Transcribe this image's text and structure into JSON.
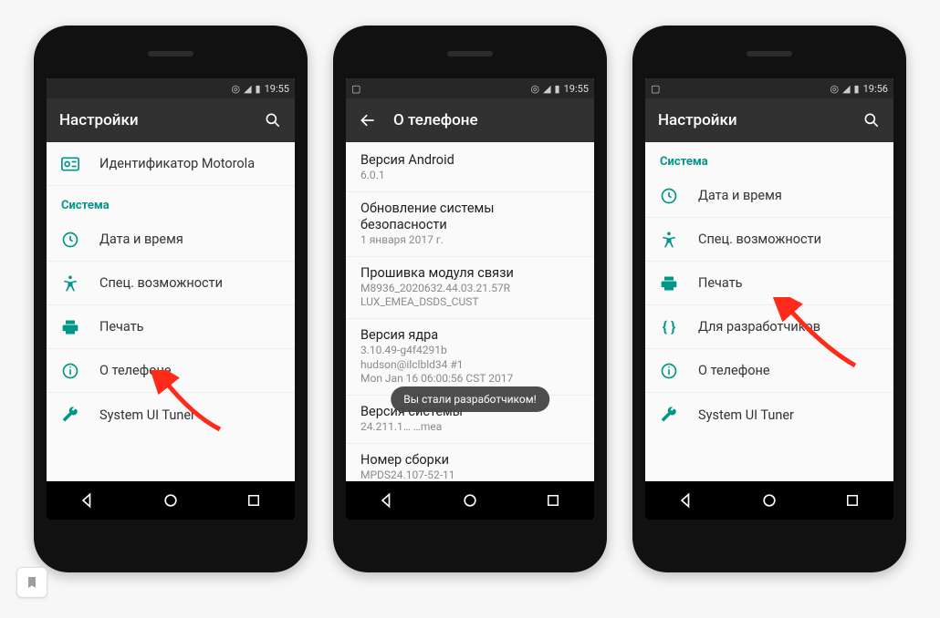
{
  "phones": [
    {
      "status": {
        "time": "19:55",
        "left_icons": [],
        "right_icons": [
          "©",
          "▲",
          "▮"
        ]
      },
      "appbar": {
        "back": false,
        "title": "Настройки",
        "search": true
      },
      "top_row": {
        "icon": "id-icon",
        "label": "Идентификатор Motorola"
      },
      "section_header": "Система",
      "items": [
        {
          "icon": "clock-icon",
          "label": "Дата и время"
        },
        {
          "icon": "access-icon",
          "label": "Спец. возможности"
        },
        {
          "icon": "print-icon",
          "label": "Печать"
        },
        {
          "icon": "info-icon",
          "label": "О телефоне"
        },
        {
          "icon": "wrench-icon",
          "label": "System UI Tuner"
        }
      ],
      "arrow_target": 3
    },
    {
      "status": {
        "time": "19:55",
        "left_icons": [
          "▢"
        ],
        "right_icons": [
          "©",
          "▲",
          "▮"
        ]
      },
      "appbar": {
        "back": true,
        "title": "О телефоне",
        "search": false
      },
      "info_blocks": [
        {
          "title": "Версия Android",
          "sub": "6.0.1"
        },
        {
          "title": "Обновление системы безопасности",
          "sub": "1 января 2017 г."
        },
        {
          "title": "Прошивка модуля связи",
          "sub": "M8936_2020632.44.03.21.57R\nLUX_EMEA_DSDS_CUST"
        },
        {
          "title": "Версия ядра",
          "sub": "3.10.49-g4f4291b\nhudson@ilclbld34 #1\nMon Jan 16 06:00:56 CST 2017"
        },
        {
          "title": "Версия системы",
          "sub": "24.211.1…                                                  …mea"
        },
        {
          "title": "Номер сборки",
          "sub": "MPDS24.107-52-11"
        }
      ],
      "toast": "Вы стали разработчиком!"
    },
    {
      "status": {
        "time": "19:56",
        "left_icons": [
          "▢"
        ],
        "right_icons": [
          "©",
          "▲",
          "▮"
        ]
      },
      "appbar": {
        "back": false,
        "title": "Настройки",
        "search": true
      },
      "section_header": "Система",
      "items": [
        {
          "icon": "clock-icon",
          "label": "Дата и время"
        },
        {
          "icon": "access-icon",
          "label": "Спец. возможности"
        },
        {
          "icon": "print-icon",
          "label": "Печать"
        },
        {
          "icon": "braces-icon",
          "label": "Для разработчиков"
        },
        {
          "icon": "info-icon",
          "label": "О телефоне"
        },
        {
          "icon": "wrench-icon",
          "label": "System UI Tuner"
        }
      ],
      "arrow_target": 3
    }
  ]
}
